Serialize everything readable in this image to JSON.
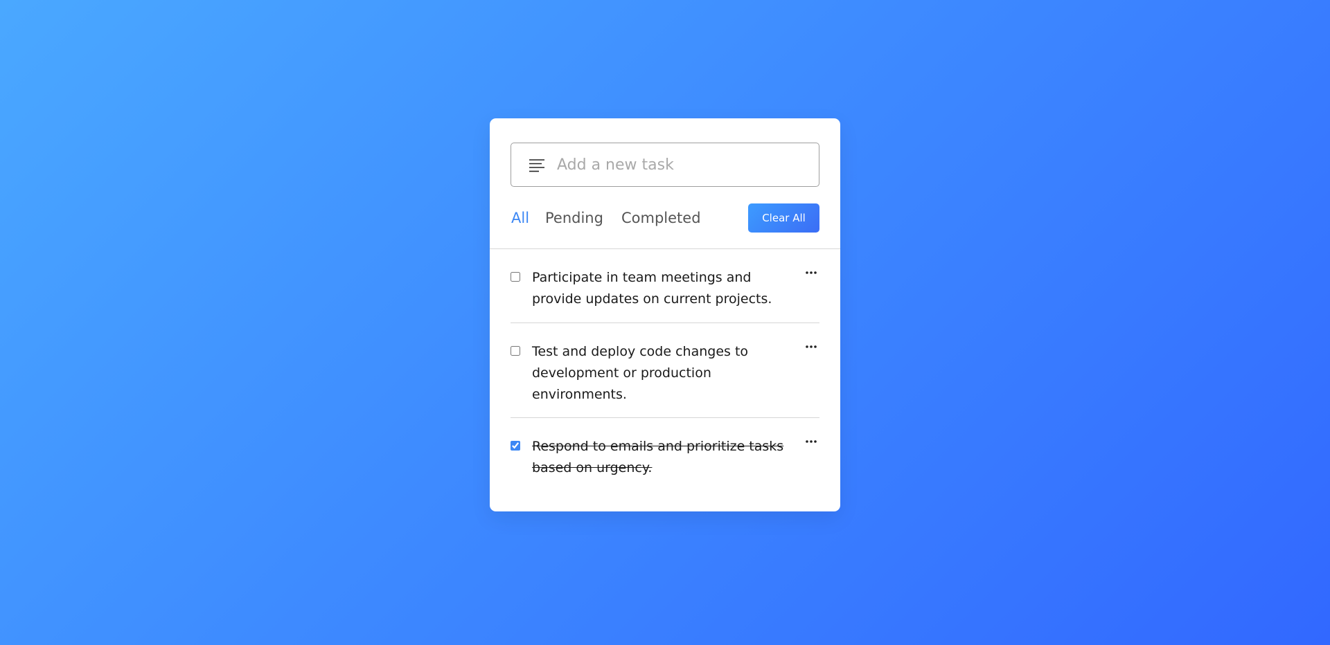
{
  "input": {
    "placeholder": "Add a new task",
    "value": ""
  },
  "filters": [
    {
      "label": "All",
      "active": true
    },
    {
      "label": "Pending",
      "active": false
    },
    {
      "label": "Completed",
      "active": false
    }
  ],
  "clear_all_label": "Clear All",
  "tasks": [
    {
      "text": "Participate in team meetings and provide updates on current projects.",
      "completed": false
    },
    {
      "text": "Test and deploy code changes to development or production environments.",
      "completed": false
    },
    {
      "text": "Respond to emails and prioritize tasks based on urgency.",
      "completed": true
    }
  ],
  "icons": {
    "input_icon": "menu-lines-icon",
    "task_menu": "ellipsis-icon"
  },
  "colors": {
    "accent": "#3c87f4",
    "background_start": "#4aa8ff",
    "background_end": "#3268ff",
    "button_start": "#3d9bff",
    "button_end": "#3b6df5"
  }
}
